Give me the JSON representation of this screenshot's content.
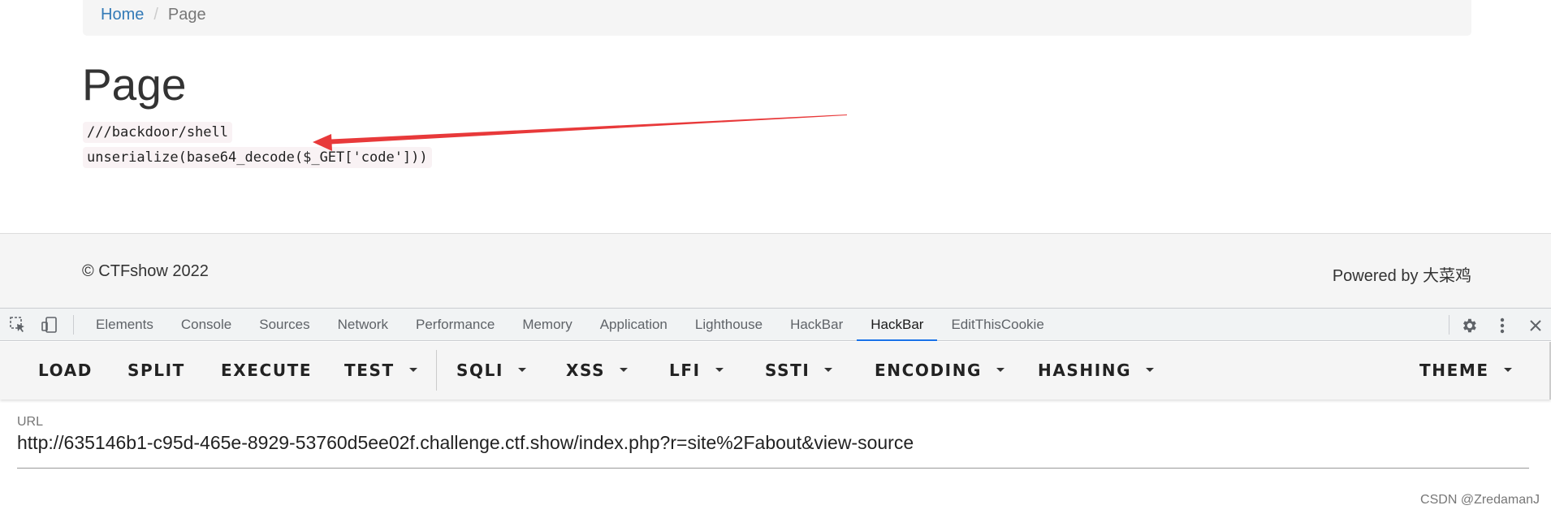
{
  "breadcrumb": {
    "home": "Home",
    "separator": "/",
    "current": "Page"
  },
  "page": {
    "title": "Page",
    "code_lines": [
      "///backdoor/shell",
      "unserialize(base64_decode($_GET['code']))"
    ]
  },
  "annotation": {
    "arrow_color": "#e8393a"
  },
  "footer": {
    "copyright": "© CTFshow 2022",
    "powered_by": "Powered by 大菜鸡"
  },
  "devtools": {
    "tabs": [
      "Elements",
      "Console",
      "Sources",
      "Network",
      "Performance",
      "Memory",
      "Application",
      "Lighthouse",
      "HackBar",
      "HackBar",
      "EditThisCookie"
    ],
    "active_tab_index": 9,
    "icons": [
      "inspect-element-icon",
      "device-toolbar-icon",
      "gear-icon",
      "more-vertical-icon",
      "close-icon"
    ],
    "accent_color": "#1a73e8"
  },
  "hackbar": {
    "buttons": {
      "load": "LOAD",
      "split": "SPLIT",
      "execute": "EXECUTE",
      "test": "TEST",
      "sqli": "SQLI",
      "xss": "XSS",
      "lfi": "LFI",
      "ssti": "SSTI",
      "encoding": "ENCODING",
      "hashing": "HASHING",
      "theme": "THEME"
    },
    "url_label": "URL",
    "url_value": "http://635146b1-c95d-465e-8929-53760d5ee02f.challenge.ctf.show/index.php?r=site%2Fabout&view-source"
  },
  "watermark": "CSDN @ZredamanJ"
}
